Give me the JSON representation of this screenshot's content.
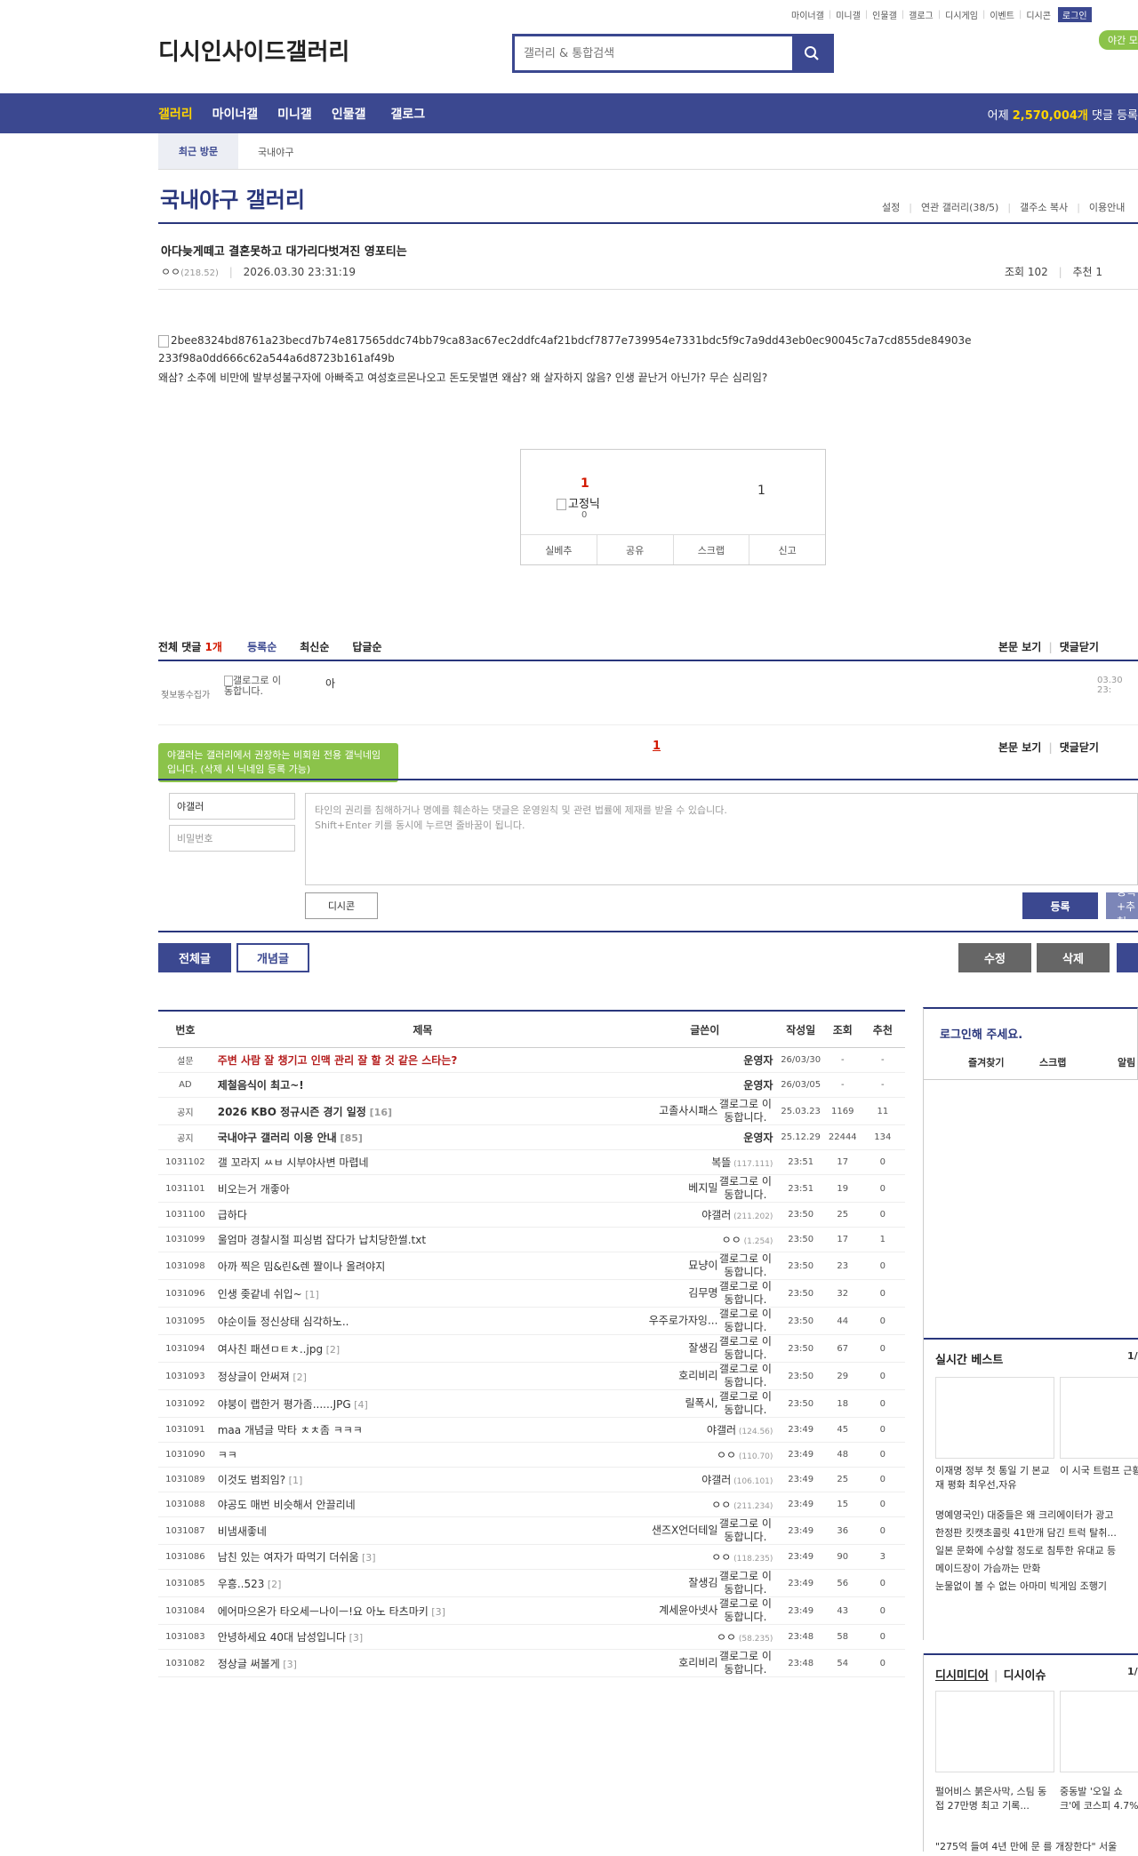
{
  "util_links": [
    "마이너갤",
    "미니갤",
    "인물갤",
    "갤로그",
    "디시게임",
    "이벤트",
    "디시콘"
  ],
  "login_label": "로그인",
  "night_label": "야간 모드",
  "logo_alt": "디시인사이드갤러리",
  "search_placeholder": "갤러리 & 통합검색",
  "gnb": {
    "items": [
      "갤러리",
      "마이너갤",
      "미니갤",
      "인물갤",
      "갤로그"
    ],
    "stat_prefix": "어제",
    "stat_count": "2,570,004개",
    "stat_suffix": "댓글 등록"
  },
  "recent": {
    "tab": "최근 방문",
    "item": "국내야구"
  },
  "gallery": {
    "title": "국내야구 갤러리",
    "tools": [
      "설정",
      "연관 갤러리(38/5)",
      "갤주소 복사",
      "이용안내"
    ]
  },
  "post": {
    "title": "아다늦게떼고 결혼못하고 대가리다벗겨진 영포티는",
    "writer": "ㅇㅇ",
    "writer_ip": "(218.52)",
    "date": "2026.03.30 23:31:19",
    "views": "조회 102",
    "recommend": "추천 1",
    "image_alt": "2bee8324bd8761a23becd7b74e817565ddc74bb79ca83ac67ec2ddfc4af21bdcf7877e739954e7331bdc5f9c7a9dd43eb0ec90045c7a7cd855de84903e233f98a0dd666c62a544a6d8723b161af49b",
    "body": "왜삼? 소추에 비만에 발부성불구자에 아빠죽고 여성호르몬나오고 돈도못벌면 왜삼? 왜 살자하지 않음? 인생 끝난거 아닌가? 무슨 심리임?"
  },
  "rec_box": {
    "up": "1",
    "fixed_label": "고정닉",
    "fixed_count": "0",
    "down": "1",
    "buttons": [
      "실베추",
      "공유",
      "스크랩",
      "신고"
    ]
  },
  "comments": {
    "total_label": "전체 댓글",
    "total_count": "1개",
    "sorts": [
      "등록순",
      "최신순",
      "답글순"
    ],
    "right_links": [
      "본문 보기",
      "댓글닫기"
    ],
    "items": [
      {
        "nick": "젖보똥수집가",
        "gallog": "갤로그로 이동합니다.",
        "text": "아",
        "date": "03.30 23:"
      }
    ],
    "page": "1",
    "tip": "야갤러는 갤러리에서 권장하는 비회원 전용 갤닉네임입니다. (삭제 시 닉네임 등록 가능)",
    "name_value": "야갤러",
    "pw_placeholder": "비밀번호",
    "textarea": "타인의 권리를 침해하거나 명예를 훼손하는 댓글은 운영원칙 및 관련 법률에 제재를 받을 수 있습니다.",
    "textarea2": "Shift+Enter 키를 동시에 누르면 줄바꿈이 됩니다.",
    "dccon": "디시콘",
    "submit": "등록",
    "submit2": "등록+추천"
  },
  "board_buttons": {
    "all": "전체글",
    "best": "개념글",
    "edit": "수정",
    "delete": "삭제"
  },
  "list": {
    "headers": [
      "번호",
      "제목",
      "글쓴이",
      "작성일",
      "조회",
      "추천"
    ],
    "rows": [
      {
        "no": "설문",
        "title": "주변 사람 잘 챙기고 인맥 관리 잘 할 것 같은 스타는?",
        "rc": "",
        "writer": "운영자",
        "wtype": "bold",
        "date": "26/03/30",
        "views": "-",
        "rec": "-",
        "kind": "survey"
      },
      {
        "no": "AD",
        "title": "제철음식이 최고~!",
        "rc": "",
        "writer": "운영자",
        "wtype": "bold",
        "date": "26/03/05",
        "views": "-",
        "rec": "-",
        "kind": "notice"
      },
      {
        "no": "공지",
        "title": "2026 KBO 정규시즌 경기 일정",
        "rc": "[16]",
        "writer": "고졸사시패스",
        "wtype": "gallog",
        "date": "25.03.23",
        "views": "1169",
        "rec": "11",
        "kind": "notice"
      },
      {
        "no": "공지",
        "title": "국내야구 갤러리 이용 안내",
        "rc": "[85]",
        "writer": "운영자",
        "wtype": "bold",
        "date": "25.12.29",
        "views": "22444",
        "rec": "134",
        "kind": "notice"
      },
      {
        "no": "1031102",
        "title": "갤 꼬라지 ㅆㅂ 시부야사변 마렵네",
        "rc": "",
        "writer": "복뜰",
        "wip": "(117.111)",
        "wtype": "ip",
        "date": "23:51",
        "views": "17",
        "rec": "0"
      },
      {
        "no": "1031101",
        "title": "비오는거 개좋아",
        "rc": "",
        "writer": "베지밀",
        "wtype": "gallog",
        "date": "23:51",
        "views": "19",
        "rec": "0"
      },
      {
        "no": "1031100",
        "title": "급하다",
        "rc": "",
        "writer": "야갤러",
        "wip": "(211.202)",
        "wtype": "ip",
        "date": "23:50",
        "views": "25",
        "rec": "0"
      },
      {
        "no": "1031099",
        "title": "울엄마 경찰시절 피싱범 잡다가 납치당한썰.txt",
        "rc": "",
        "writer": "ㅇㅇ",
        "wip": "(1.254)",
        "wtype": "ip",
        "date": "23:50",
        "views": "17",
        "rec": "1"
      },
      {
        "no": "1031098",
        "title": "아까 찍은 밈&린&렌 짤이나 올려야지",
        "rc": "",
        "writer": "묘냥이",
        "wtype": "gallog",
        "date": "23:50",
        "views": "23",
        "rec": "0"
      },
      {
        "no": "1031096",
        "title": "인생 좆같네 쉬입~",
        "rc": "[1]",
        "writer": "김무명",
        "wtype": "gallog",
        "date": "23:50",
        "views": "32",
        "rec": "0"
      },
      {
        "no": "1031095",
        "title": "야순이들 정신상태 심각하노..",
        "rc": "",
        "writer": "우주로가자잉...",
        "wtype": "gallog",
        "date": "23:50",
        "views": "44",
        "rec": "0"
      },
      {
        "no": "1031094",
        "title": "여사친 패션ㅁㅌㅊ..jpg",
        "rc": "[2]",
        "writer": "잘생김",
        "wtype": "gallog",
        "date": "23:50",
        "views": "67",
        "rec": "0"
      },
      {
        "no": "1031093",
        "title": "정상글이 안써져",
        "rc": "[2]",
        "writer": "호리비리",
        "wtype": "gallog",
        "date": "23:50",
        "views": "29",
        "rec": "0"
      },
      {
        "no": "1031092",
        "title": "야붕이 랩한거 평가좀......JPG",
        "rc": "[4]",
        "writer": "릴폭시,",
        "wtype": "gallog",
        "date": "23:50",
        "views": "18",
        "rec": "0"
      },
      {
        "no": "1031091",
        "title": "maa 개념글 막타 ㅊㅊ좀 ㅋㅋㅋ",
        "rc": "",
        "writer": "야갤러",
        "wip": "(124.56)",
        "wtype": "ip",
        "date": "23:49",
        "views": "45",
        "rec": "0"
      },
      {
        "no": "1031090",
        "title": "ㅋㅋ",
        "rc": "",
        "writer": "ㅇㅇ",
        "wip": "(110.70)",
        "wtype": "ip",
        "date": "23:49",
        "views": "48",
        "rec": "0"
      },
      {
        "no": "1031089",
        "title": "이것도 범죄임?",
        "rc": "[1]",
        "writer": "야갤러",
        "wip": "(106.101)",
        "wtype": "ip",
        "date": "23:49",
        "views": "25",
        "rec": "0"
      },
      {
        "no": "1031088",
        "title": "야공도 매번 비슷해서 안끌리네",
        "rc": "",
        "writer": "ㅇㅇ",
        "wip": "(211.234)",
        "wtype": "ip",
        "date": "23:49",
        "views": "15",
        "rec": "0"
      },
      {
        "no": "1031087",
        "title": "비냄새좋네",
        "rc": "",
        "writer": "샌즈X언더테일",
        "wtype": "gallog",
        "date": "23:49",
        "views": "36",
        "rec": "0"
      },
      {
        "no": "1031086",
        "title": "남친 있는 여자가 따먹기 더쉬움",
        "rc": "[3]",
        "writer": "ㅇㅇ",
        "wip": "(118.235)",
        "wtype": "ip",
        "date": "23:49",
        "views": "90",
        "rec": "3"
      },
      {
        "no": "1031085",
        "title": "우흥..523",
        "rc": "[2]",
        "writer": "잘생김",
        "wtype": "gallog",
        "date": "23:49",
        "views": "56",
        "rec": "0"
      },
      {
        "no": "1031084",
        "title": "에어마으온가 타오세ㅡ나이ㅡ!요 아노 타츠마키",
        "rc": "[3]",
        "writer": "계세윤아넷사",
        "wtype": "gallog",
        "date": "23:49",
        "views": "43",
        "rec": "0"
      },
      {
        "no": "1031083",
        "title": "안녕하세요 40대 남성입니다",
        "rc": "[3]",
        "writer": "ㅇㅇ",
        "wip": "(58.235)",
        "wtype": "ip",
        "date": "23:48",
        "views": "58",
        "rec": "0"
      },
      {
        "no": "1031082",
        "title": "정상글 써볼게",
        "rc": "[3]",
        "writer": "호리비리",
        "wtype": "gallog",
        "date": "23:48",
        "views": "54",
        "rec": "0"
      }
    ],
    "gallog_text": "갤로그로 이동합니다."
  },
  "right": {
    "login_title": "로그인해 주세요.",
    "login_links": [
      "즐겨찾기",
      "스크랩",
      "알림"
    ],
    "best1": {
      "title": "실시간 베스트",
      "page": "1/",
      "cap1": "이재명 정부 첫 통일 기 본교재 평화 최우선,자유",
      "cap2": "이 시국 트럼프 근황",
      "items": [
        "명예영국인) 대중들은 왜 크리에이터가 광고",
        "한정판 킷캣초콜릿 41만개 담긴 트럭 탈취...",
        "일본 문화에 수상할 정도로 침투한 유대교 등",
        "메이드장이 가슴까는 만화",
        "눈물없이 볼 수 없는 아마미 빅게임 조행기"
      ]
    },
    "best2": {
      "title": "디시미디어",
      "title2": "디시이슈",
      "page": "1/",
      "cap1": "펄어비스 붉은사막, 스팀 동접 27만명 최고 기록...",
      "cap2": "중동발 '오일 쇼크'에 코스피 4.7%",
      "items": [
        "\"275억 들여 4년 만에 문 를 개장한다\" 서울"
      ]
    }
  }
}
